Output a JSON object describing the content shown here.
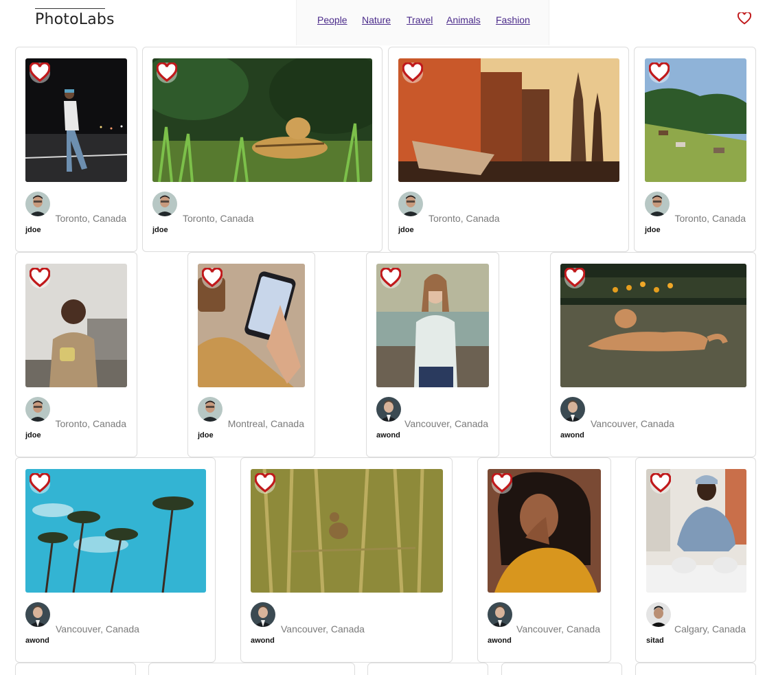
{
  "app": {
    "logo": "PhotoLabs",
    "accent": "#c0191b"
  },
  "nav": {
    "topics": [
      {
        "label": "People"
      },
      {
        "label": "Nature"
      },
      {
        "label": "Travel"
      },
      {
        "label": "Animals"
      },
      {
        "label": "Fashion"
      }
    ],
    "fav_icon": "heart-icon"
  },
  "photos": [
    {
      "subject": "man-walking-night",
      "location": "Toronto, Canada",
      "username": "jdoe"
    },
    {
      "subject": "jaguar-grass",
      "location": "Toronto, Canada",
      "username": "jdoe"
    },
    {
      "subject": "city-street-temple",
      "location": "Toronto, Canada",
      "username": "jdoe"
    },
    {
      "subject": "horses-field",
      "location": "Toronto, Canada",
      "username": "jdoe"
    },
    {
      "subject": "man-sofa-mug",
      "location": "Toronto, Canada",
      "username": "jdoe"
    },
    {
      "subject": "hand-phone",
      "location": "Montreal, Canada",
      "username": "jdoe"
    },
    {
      "subject": "woman-lake",
      "location": "Vancouver, Canada",
      "username": "awond"
    },
    {
      "subject": "dog-lawn",
      "location": "Vancouver, Canada",
      "username": "awond"
    },
    {
      "subject": "palm-trees-sky",
      "location": "Vancouver, Canada",
      "username": "awond"
    },
    {
      "subject": "bird-reeds",
      "location": "Vancouver, Canada",
      "username": "awond"
    },
    {
      "subject": "woman-yellow-sweater",
      "location": "Vancouver, Canada",
      "username": "awond"
    },
    {
      "subject": "man-crouching-denim",
      "location": "Calgary, Canada",
      "username": "sitad"
    }
  ]
}
